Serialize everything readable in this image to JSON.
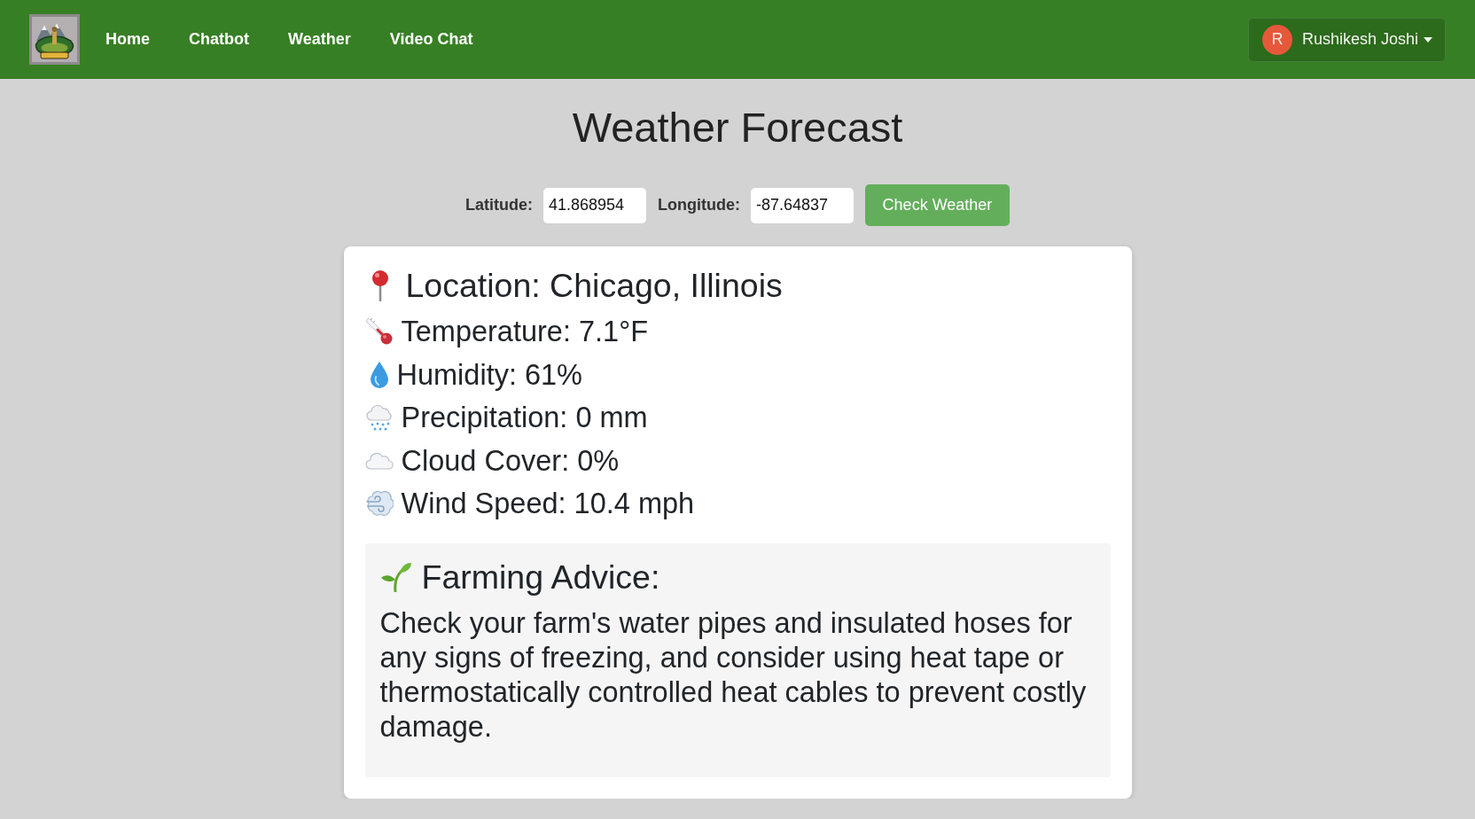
{
  "navbar": {
    "links": [
      {
        "label": "Home"
      },
      {
        "label": "Chatbot"
      },
      {
        "label": "Weather"
      },
      {
        "label": "Video Chat"
      }
    ],
    "user_menu": {
      "initial": "R",
      "name": "Rushikesh Joshi"
    }
  },
  "title": "Weather Forecast",
  "coordinates_form": {
    "fields": [
      {
        "label": "Latitude:",
        "value": "41.868954"
      },
      {
        "label": "Longitude:",
        "value": "-87.64837"
      }
    ],
    "submit_button": "Check Weather"
  },
  "weather_card": {
    "location": "Location: Chicago, Illinois",
    "readings": [
      {
        "kind": "temperature",
        "text": "Temperature: 7.1°F"
      },
      {
        "kind": "humidity",
        "text": "Humidity: 61%"
      },
      {
        "kind": "precipitation",
        "text": "Precipitation: 0 mm"
      },
      {
        "kind": "cloud_cover",
        "text": "Cloud Cover: 0%"
      },
      {
        "kind": "wind",
        "text": "Wind Speed: 10.4 mph"
      }
    ],
    "advice": {
      "title": "Farming Advice:",
      "text": "Check your farm's water pipes and insulated hoses for any signs of freezing, and consider using heat tape or thermostatically controlled heat cables to prevent costly damage."
    }
  }
}
